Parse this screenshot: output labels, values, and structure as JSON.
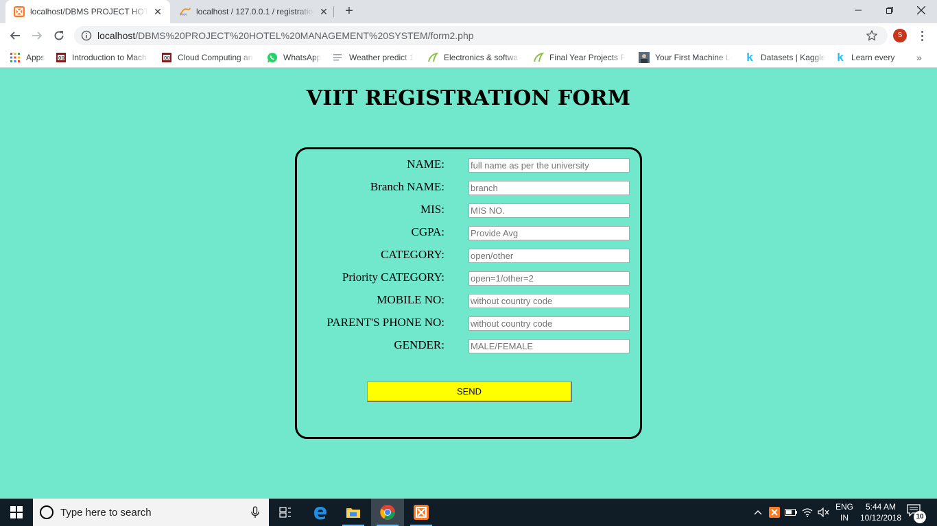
{
  "browser": {
    "tabs": [
      {
        "title": "localhost/DBMS PROJECT HOTEL",
        "icon": "xampp-icon",
        "active": true
      },
      {
        "title": "localhost / 127.0.0.1 / registration",
        "icon": "phpmyadmin-icon",
        "active": false
      }
    ],
    "address_bar": {
      "host": "localhost",
      "path": "/DBMS%20PROJECT%20HOTEL%20MANAGEMENT%20SYSTEM/form2.php"
    },
    "profile_initial": "S",
    "bookmarks": [
      {
        "label": "Apps",
        "icon": "apps-grid-icon"
      },
      {
        "label": "Introduction to Mach",
        "icon": "course-icon"
      },
      {
        "label": "Cloud Computing an",
        "icon": "course-icon"
      },
      {
        "label": "WhatsApp",
        "icon": "whatsapp-icon"
      },
      {
        "label": "Weather predict 1",
        "icon": "list-icon"
      },
      {
        "label": "Electronics & softwa",
        "icon": "leaf-icon"
      },
      {
        "label": "Final Year Projects Fo",
        "icon": "leaf-icon"
      },
      {
        "label": "Your First Machine Le",
        "icon": "person-icon"
      },
      {
        "label": "Datasets | Kaggle",
        "icon": "kaggle-icon"
      },
      {
        "label": "Learn every",
        "icon": "kaggle-icon"
      }
    ]
  },
  "page": {
    "title": "VIIT REGISTRATION FORM",
    "fields": [
      {
        "label": "NAME:",
        "placeholder": "full name as per the university"
      },
      {
        "label": "Branch NAME:",
        "placeholder": "branch"
      },
      {
        "label": "MIS:",
        "placeholder": "MIS NO."
      },
      {
        "label": "CGPA:",
        "placeholder": "Provide Avg"
      },
      {
        "label": "CATEGORY:",
        "placeholder": "open/other"
      },
      {
        "label": "Priority CATEGORY:",
        "placeholder": "open=1/other=2"
      },
      {
        "label": "MOBILE NO:",
        "placeholder": "without country code"
      },
      {
        "label": "PARENT'S PHONE NO:",
        "placeholder": "without country code"
      },
      {
        "label": "GENDER:",
        "placeholder": "MALE/FEMALE"
      }
    ],
    "submit_label": "SEND",
    "colors": {
      "background": "#71e7cc",
      "button": "#ffff00",
      "button_text": "#000080"
    }
  },
  "taskbar": {
    "search_placeholder": "Type here to search",
    "language": "ENG",
    "region": "IN",
    "time": "5:44 AM",
    "date": "10/12/2018",
    "notifications": "10"
  }
}
